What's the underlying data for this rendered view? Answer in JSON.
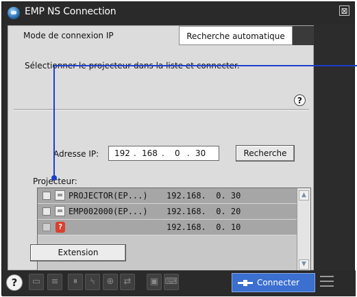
{
  "window": {
    "title": "EMP NS Connection",
    "close_glyph": "⊠"
  },
  "tabs": {
    "active": "Mode de connexion IP",
    "inactive": "Recherche automatique"
  },
  "instruction": "Sélectionner le projecteur dans la liste et connecter.",
  "help_glyph": "?",
  "ip": {
    "label": "Adresse IP:",
    "octet1": "192",
    "octet2": "168",
    "octet3": "0",
    "octet4": "30",
    "dot": "."
  },
  "search_button": "Recherche",
  "projector_label": "Projecteur:",
  "projectors": [
    {
      "name": "PROJECTOR(EP...)",
      "ip": "192.168.  0. 30",
      "icon": "projector-icon"
    },
    {
      "name": "EMP002000(EP...)",
      "ip": "192.168.  0. 20",
      "icon": "projector-icon"
    },
    {
      "name": "",
      "ip": "192.168.  0. 10",
      "icon": "unknown-projector-icon",
      "unknown_glyph": "?"
    }
  ],
  "extension_button": "Extension",
  "toolbar": {
    "help": "?",
    "connect_label": "Connecter"
  },
  "colors": {
    "accent": "#3b6fd0",
    "callout": "#1a3fc8"
  }
}
